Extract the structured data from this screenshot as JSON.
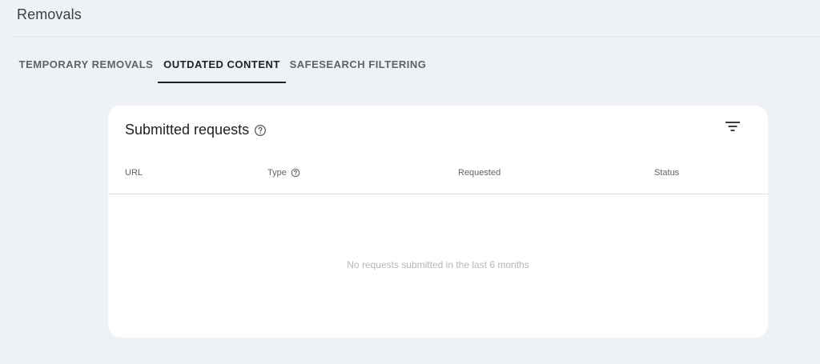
{
  "page": {
    "title": "Removals"
  },
  "tabs": [
    {
      "label": "TEMPORARY REMOVALS",
      "active": false
    },
    {
      "label": "OUTDATED CONTENT",
      "active": true
    },
    {
      "label": "SAFESEARCH FILTERING",
      "active": false
    }
  ],
  "card": {
    "title": "Submitted requests",
    "title_icon": "help-circle-icon",
    "filter_icon": "filter-icon",
    "columns": {
      "url": "URL",
      "type": "Type",
      "type_icon": "help-circle-icon",
      "requested": "Requested",
      "status": "Status"
    },
    "empty_message": "No requests submitted in the last 6 months"
  },
  "colors": {
    "background": "#eef1f6",
    "card": "#ffffff",
    "active_tab": "#202124",
    "inactive_tab": "#5f6368",
    "muted_text": "#b4b7bb"
  }
}
